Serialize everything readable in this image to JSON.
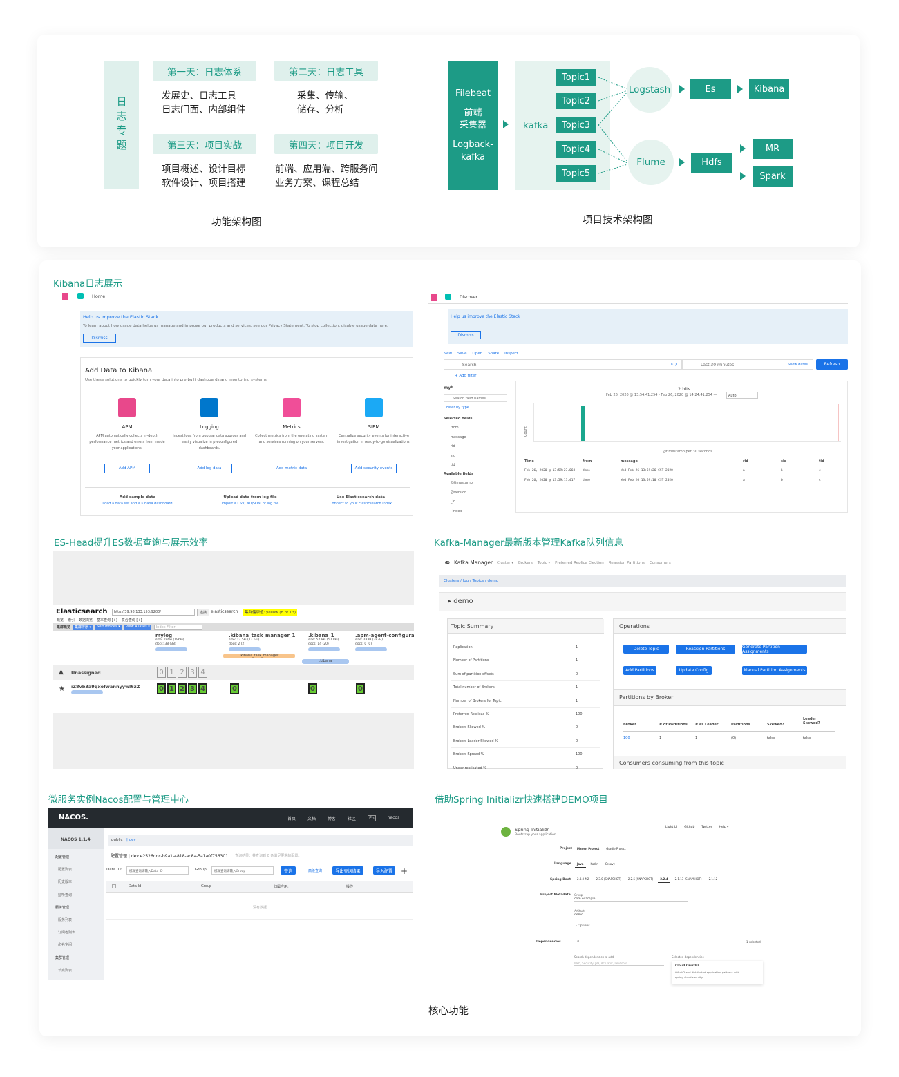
{
  "top_left": {
    "vertical_title": "日志专题",
    "days": [
      {
        "title": "第一天：日志体系",
        "lines": [
          "发展史、日志工具",
          "日志门面、内部组件"
        ]
      },
      {
        "title": "第二天：日志工具",
        "lines": [
          "采集、传输、",
          "储存、分析"
        ]
      },
      {
        "title": "第三天：项目实战",
        "lines": [
          "项目概述、设计目标",
          "软件设计、项目搭建"
        ]
      },
      {
        "title": "第四天：项目开发",
        "lines": [
          "前端、应用端、跨服务间",
          "业务方案、课程总结"
        ]
      }
    ],
    "caption": "功能架构图"
  },
  "top_right": {
    "filebeat": [
      "Filebeat",
      "前端",
      "采集器",
      "Logback-",
      "kafka"
    ],
    "kafka": "kafka",
    "topics": [
      "Topic1",
      "Topic2",
      "Topic3",
      "Topic4",
      "Topic5"
    ],
    "logstash": "Logstash",
    "flume": "Flume",
    "es": "Es",
    "kibana": "Kibana",
    "hdfs": "Hdfs",
    "mr": "MR",
    "spark": "Spark",
    "caption": "项目技术架构图",
    "colors": {
      "accent": "#1d9b86",
      "light": "#e6f3ef"
    }
  },
  "sections": {
    "kibana": "Kibana日志展示",
    "eshead": "ES-Head提升ES数据查询与展示效率",
    "kafkamgr": "Kafka-Manager最新版本管理Kafka队列信息",
    "nacos": "微服务实例Nacos配置与管理中心",
    "spring": "借助Spring Initializr快速搭建DEMO项目"
  },
  "kibana_home": {
    "tab": "Home",
    "banner_title": "Help us improve the Elastic Stack",
    "banner_text": "To learn about how usage data helps us manage and improve our products and services, see our Privacy Statement. To stop collection, disable usage data here.",
    "dismiss": "Dismiss",
    "heading": "Add Data to Kibana",
    "sub": "Use these solutions to quickly turn your data into pre-built dashboards and monitoring systems.",
    "tiles": [
      {
        "name": "APM",
        "desc": "APM automatically collects in-depth performance metrics and errors from inside your applications.",
        "btn": "Add APM"
      },
      {
        "name": "Logging",
        "desc": "Ingest logs from popular data sources and easily visualize in preconfigured dashboards.",
        "btn": "Add log data"
      },
      {
        "name": "Metrics",
        "desc": "Collect metrics from the operating system and services running on your servers.",
        "btn": "Add metric data"
      },
      {
        "name": "SIEM",
        "desc": "Centralize security events for interactive investigation in ready-to-go visualizations.",
        "btn": "Add security events"
      }
    ],
    "footer": [
      {
        "t": "Add sample data",
        "l": "Load a data set and a Kibana dashboard"
      },
      {
        "t": "Upload data from log file",
        "l": "Import a CSV, NDJSON, or log file"
      },
      {
        "t": "Use Elasticsearch data",
        "l": "Connect to your Elasticsearch index"
      }
    ]
  },
  "kibana_discover": {
    "tab": "Discover",
    "banner_title": "Help us improve the Elastic Stack",
    "dismiss": "Dismiss",
    "menu": [
      "New",
      "Save",
      "Open",
      "Share",
      "Inspect"
    ],
    "search": "Search",
    "kql": "KQL",
    "time": "Last 30 minutes",
    "show_dates": "Show dates",
    "refresh": "Refresh",
    "add_filter": "+ Add filter",
    "index": "my*",
    "field_search": "Search field names",
    "filter_type": "Filter by type",
    "selected_fields": "Selected fields",
    "fields": [
      "from",
      "message",
      "rid",
      "sid",
      "tid"
    ],
    "available_fields": "Available fields",
    "avail": [
      "@timestamp",
      "@version",
      "_id",
      "_index"
    ],
    "hits": "2 hits",
    "range": "Feb 26, 2020 @ 13:54:41.254 - Feb 26, 2020 @ 14:24:41.254 —",
    "auto": "Auto",
    "axis_label": "@timestamp per 30 seconds",
    "count": "Count",
    "cols": [
      "Time",
      "from",
      "message",
      "rid",
      "sid",
      "tid"
    ],
    "rows": [
      [
        "Feb 26, 2020 @ 13:59:27.068",
        "demo",
        "Wed Feb 26 13:59:26 CST 2020",
        "a",
        "b",
        "c"
      ],
      [
        "Feb 26, 2020 @ 13:59:11.417",
        "demo",
        "Wed Feb 26 13:59:10 CST 2020",
        "a",
        "b",
        "c"
      ]
    ]
  },
  "eshead": {
    "title": "Elasticsearch",
    "url": "http://39.98.133.153:9200/",
    "connect": "连接",
    "cluster": "elasticsearch",
    "health": "集群健康值: yellow (8 of 13)",
    "tabs": [
      "概览",
      "索引",
      "数据浏览",
      "基本查询 [+]",
      "复合查询 [+]"
    ],
    "toolbar": [
      "集群概览",
      "集群排序 ▾",
      "Sort Indices ▾",
      "View Aliases ▾"
    ],
    "filter": "Index Filter",
    "indices": [
      {
        "name": "mylog",
        "size": "size: 196ki (196ki)",
        "docs": "docs: 38 (38)"
      },
      {
        "name": ".kibana_task_manager_1",
        "size": "size: 12.5ki (12.5ki)",
        "docs": "docs: 2 (2)"
      },
      {
        "name": ".kibana_1",
        "size": "size: 57.8ki (57.8ki)",
        "docs": "docs: 14 (20)"
      },
      {
        "name": ".apm-agent-configurat",
        "size": "size: 283B (283B)",
        "docs": "docs: 0 (0)"
      }
    ],
    "alias1": ".kibana_task_manager",
    "alias2": ".kibana",
    "unassigned": "Unassigned",
    "node": "iZ8vb3a9qxofwannyywl6zZ",
    "shards": [
      "0",
      "1",
      "2",
      "3",
      "4"
    ]
  },
  "kafkamgr": {
    "brand": "Kafka Manager",
    "nav": [
      "Cluster ▾",
      "Brokers",
      "Topic ▾",
      "Preferred Replica Election",
      "Reassign Partitions",
      "Consumers"
    ],
    "crumbs": "Clusters / log / Topics / demo",
    "topic": "demo",
    "summary_title": "Topic Summary",
    "summary": [
      [
        "Replication",
        "1"
      ],
      [
        "Number of Partitions",
        "1"
      ],
      [
        "Sum of partition offsets",
        "0"
      ],
      [
        "Total number of Brokers",
        "1"
      ],
      [
        "Number of Brokers for Topic",
        "1"
      ],
      [
        "Preferred Replicas %",
        "100"
      ],
      [
        "Brokers Skewed %",
        "0"
      ],
      [
        "Brokers Leader Skewed %",
        "0"
      ],
      [
        "Brokers Spread %",
        "100"
      ],
      [
        "Under-replicated %",
        "0"
      ]
    ],
    "ops_title": "Operations",
    "ops": [
      "Delete Topic",
      "Reassign Partitions",
      "Generate Partition Assignments",
      "Add Partitions",
      "Update Config",
      "Manual Partition Assignments"
    ],
    "pbb_title": "Partitions by Broker",
    "pbb_cols": [
      "Broker",
      "# of Partitions",
      "# as Leader",
      "Partitions",
      "Skewed?",
      "Leader Skewed?"
    ],
    "pbb_row": [
      "100",
      "1",
      "1",
      "(0)",
      "false",
      "false"
    ],
    "consumers": "Consumers consuming from this topic"
  },
  "nacos": {
    "logo": "NACOS.",
    "version": "NACOS 1.1.4",
    "topnav": [
      "首页",
      "文档",
      "博客",
      "社区",
      "En",
      "nacos"
    ],
    "menu": [
      "配置管理",
      "配置列表",
      "历史版本",
      "监听查询",
      "服务管理",
      "服务列表",
      "订阅者列表",
      "命名空间",
      "集群管理",
      "节点列表"
    ],
    "ns": [
      "public",
      "dev"
    ],
    "title": "配置管理 | dev e2526ddc-b9a1-4818-ac8a-5a1a0f756301",
    "hint": "查询结果：共查询到 0 条满足要求的配置。",
    "dataid": "Data ID:",
    "dataid_ph": "模糊查询请输入Data ID",
    "group": "Group:",
    "group_ph": "模糊查询请输入Group",
    "query": "查询",
    "adv": "高级查询",
    "export": "导出查询结果",
    "import": "导入配置",
    "cols": [
      "Data Id",
      "Group",
      "归属应用:",
      "操作"
    ],
    "empty": "没有数据"
  },
  "spring": {
    "brand": "Spring Initializr",
    "tag": "Bootstrap your application",
    "top": [
      "Light UI",
      "Github",
      "Twitter",
      "Help ▾"
    ],
    "project": "Project",
    "projects": [
      "Maven Project",
      "Gradle Project"
    ],
    "language": "Language",
    "languages": [
      "Java",
      "Kotlin",
      "Groovy"
    ],
    "boot": "Spring Boot",
    "boots": [
      "2.3.0 M2",
      "2.3.0 (SNAPSHOT)",
      "2.2.5 (SNAPSHOT)",
      "2.2.4",
      "2.1.13 (SNAPSHOT)",
      "2.1.12"
    ],
    "meta": "Project Metadata",
    "group_l": "Group",
    "group_v": "com.example",
    "artifact_l": "Artifact",
    "artifact_v": "demo",
    "options": "Options",
    "deps": "Dependencies",
    "selected": "1 selected",
    "search_l": "Search dependencies to add",
    "search_ph": "Web, Security, JPA, Actuator, Devtools...",
    "sel_l": "Selected dependencies",
    "dep_name": "Cloud OAuth2",
    "dep_desc": "OAuth2 and distributed application patterns with spring-cloud-security."
  },
  "bottom_caption": "核心功能"
}
